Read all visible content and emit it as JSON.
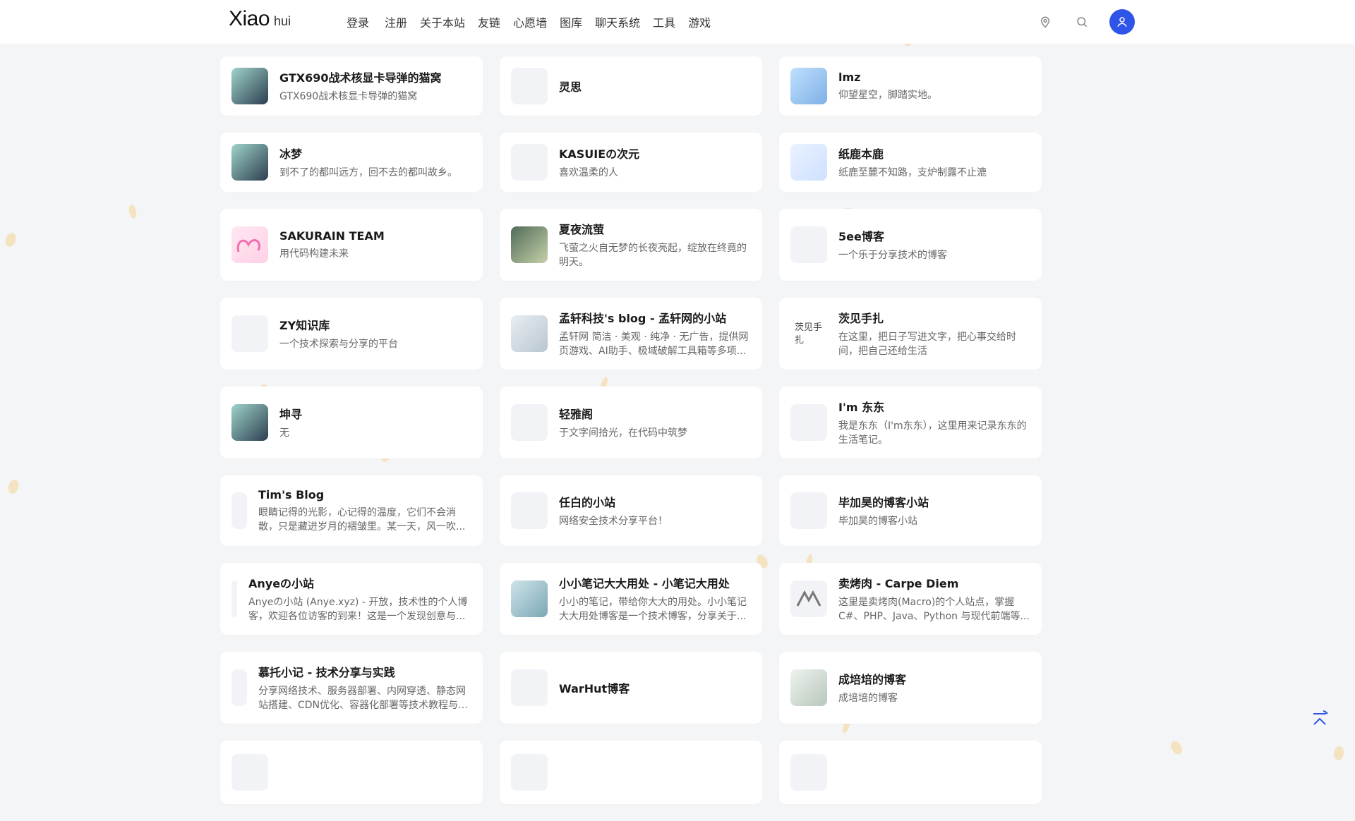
{
  "header": {
    "logo_main": "Xiao",
    "logo_sub": "hui",
    "nav": [
      "登录",
      "注册",
      "关于本站",
      "友链",
      "心愿墙",
      "图库",
      "聊天系统",
      "工具",
      "游戏"
    ],
    "icons": [
      "location-icon",
      "search-icon",
      "user-icon"
    ],
    "accent_color": "#2e55e8"
  },
  "links": [
    [
      {
        "title": "",
        "desc": "",
        "thumb": "avatar-icon"
      },
      {
        "title": "",
        "desc": "",
        "thumb": "placeholder"
      },
      {
        "title": "",
        "desc": "",
        "thumb": "avatar-icon"
      }
    ],
    [
      {
        "title": "GTX690战术核显卡导弹的猫窝",
        "desc": "GTX690战术核显卡导弹的猫窝",
        "thumb": "anime-avatar"
      },
      {
        "title": "灵思",
        "desc": "",
        "thumb": "placeholder"
      },
      {
        "title": "lmz",
        "desc": "仰望星空，脚踏实地。",
        "thumb": "bird-avatar"
      }
    ],
    [
      {
        "title": "冰梦",
        "desc": "到不了的都叫远方，回不去的都叫故乡。",
        "thumb": "anime-avatar"
      },
      {
        "title": "KASUIEの次元",
        "desc": "喜欢温柔的人",
        "thumb": "placeholder"
      },
      {
        "title": "纸鹿本鹿",
        "desc": "纸鹿至麓不知路，支炉制露不止漉",
        "thumb": "blue-logo"
      }
    ],
    [
      {
        "title": "SAKURAIN TEAM",
        "desc": "用代码构建未来",
        "thumb": "pink-logo"
      },
      {
        "title": "夏夜流萤",
        "desc": "飞萤之火自无梦的长夜亮起，绽放在终竟的明天。",
        "thumb": "photo-avatar"
      },
      {
        "title": "5ee博客",
        "desc": "一个乐于分享技术的博客",
        "thumb": "placeholder"
      }
    ],
    [
      {
        "title": "ZY知识库",
        "desc": "一个技术探索与分享的平台",
        "thumb": "placeholder"
      },
      {
        "title": "孟轩科技's blog - 孟轩网的小站",
        "desc": "孟轩网 简洁 · 美观 · 纯净 · 无广告，提供网页游戏、AI助手、极域破解工具箱等多项...",
        "thumb": "pixel-avatar"
      },
      {
        "title": "茨见手扎",
        "desc": "在这里，把日子写进文字，把心事交给时间，把自己还给生活",
        "thumb": "broken-image",
        "thumb_alt": "茨见手扎"
      }
    ],
    [
      {
        "title": "坤寻",
        "desc": "无",
        "thumb": "anime-avatar"
      },
      {
        "title": "轻雅阁",
        "desc": "于文字间拾光，在代码中筑梦",
        "thumb": "placeholder"
      },
      {
        "title": "I'm 东东",
        "desc": "我是东东（I'm东东），这里用来记录东东的生活笔记。",
        "thumb": "placeholder"
      }
    ],
    [
      {
        "title": "Tim's Blog",
        "desc": "眼睛记得的光影，心记得的温度，它们不会消散，只是藏进岁月的褶皱里。某一天，风一吹...",
        "thumb": "narrow-placeholder"
      },
      {
        "title": "任白的小站",
        "desc": "网络安全技术分享平台！",
        "thumb": "placeholder"
      },
      {
        "title": "毕加昊的博客小站",
        "desc": "毕加昊的博客小站",
        "thumb": "placeholder"
      }
    ],
    [
      {
        "title": "Anyeの小站",
        "desc": "Anyeの小站 (Anye.xyz) - 开放，技术性的个人博客，欢迎各位访客的到来！这是一个发现创意与...",
        "thumb": "thin-placeholder"
      },
      {
        "title": "小小笔记大大用处 - 小笔记大用处",
        "desc": "小小的笔记，带给你大大的用处。小小笔记大大用处博客是一个技术博客，分享关于...",
        "thumb": "mascot-avatar"
      },
      {
        "title": "卖烤肉 - Carpe Diem",
        "desc": "这里是卖烤肉(Macro)的个人站点，掌握C#、PHP、Java、Python 与现代前端等...",
        "thumb": "m-logo"
      }
    ],
    [
      {
        "title": "慕托小记 - 技术分享与实践",
        "desc": "分享网络技术、服务器部署、内网穿透、静态网站搭建、CDN优化、容器化部署等技术教程与实...",
        "thumb": "narrow-placeholder"
      },
      {
        "title": "WarHut博客",
        "desc": "",
        "thumb": "placeholder"
      },
      {
        "title": "成培培的博客",
        "desc": "成培培的博客",
        "thumb": "sketch-avatar"
      }
    ],
    [
      {
        "title": "",
        "desc": "",
        "thumb": "placeholder"
      },
      {
        "title": "",
        "desc": "",
        "thumb": "placeholder"
      },
      {
        "title": "",
        "desc": "",
        "thumb": "placeholder"
      }
    ]
  ]
}
